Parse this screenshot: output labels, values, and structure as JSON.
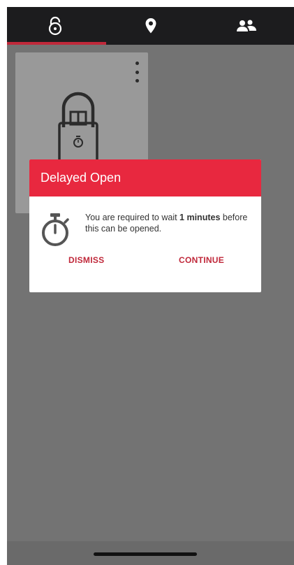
{
  "tabs": [
    {
      "icon": "padlock-icon",
      "active": true
    },
    {
      "icon": "location-pin-icon",
      "active": false
    },
    {
      "icon": "users-icon",
      "active": false
    }
  ],
  "colors": {
    "accent": "#e8283f",
    "accent_text": "#c0283a",
    "tabbar_bg": "#1c1c1e",
    "overlay_bg": "#737373"
  },
  "card": {
    "icons": [
      "more-vertical-icon",
      "padlock-timer-icon"
    ]
  },
  "dialog": {
    "title": "Delayed Open",
    "icon": "stopwatch-icon",
    "message_prefix": "You are required to wait ",
    "message_bold": "1 minutes",
    "message_suffix": " before this can be opened.",
    "dismiss_label": "DISMISS",
    "continue_label": "CONTINUE"
  }
}
